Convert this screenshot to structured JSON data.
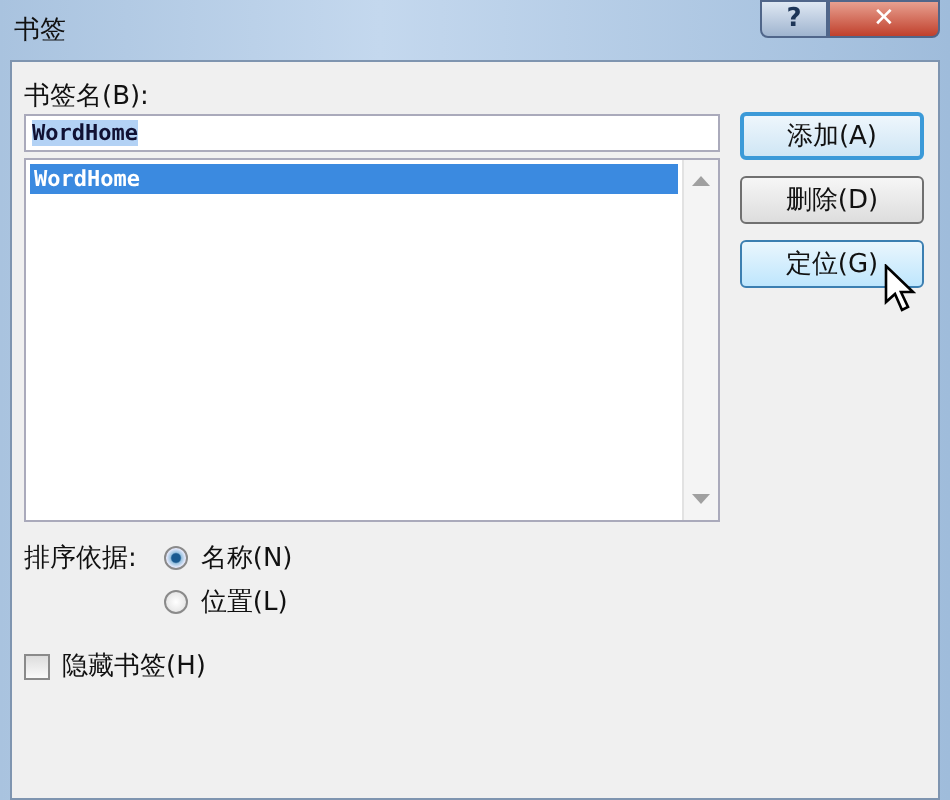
{
  "window": {
    "title": "书签",
    "title_buttons": [
      {
        "kind": "help",
        "label": "?"
      },
      {
        "kind": "close",
        "label": "✕"
      }
    ]
  },
  "name_field": {
    "label": "书签名(B):",
    "value": "WordHome",
    "text_selected": true
  },
  "bookmarks": [
    {
      "label": "WordHome",
      "selected": true
    }
  ],
  "buttons": [
    {
      "label": "添加(A)",
      "default": true,
      "hovered": false
    },
    {
      "label": "删除(D)",
      "default": false,
      "hovered": false
    },
    {
      "label": "定位(G)",
      "default": false,
      "hovered": true
    }
  ],
  "sort": {
    "label": "排序依据:",
    "options": [
      {
        "label": "名称(N)",
        "selected": true
      },
      {
        "label": "位置(L)",
        "selected": false
      }
    ]
  },
  "hide_bookmarks": {
    "label": "隐藏书签(H)",
    "checked": false
  }
}
